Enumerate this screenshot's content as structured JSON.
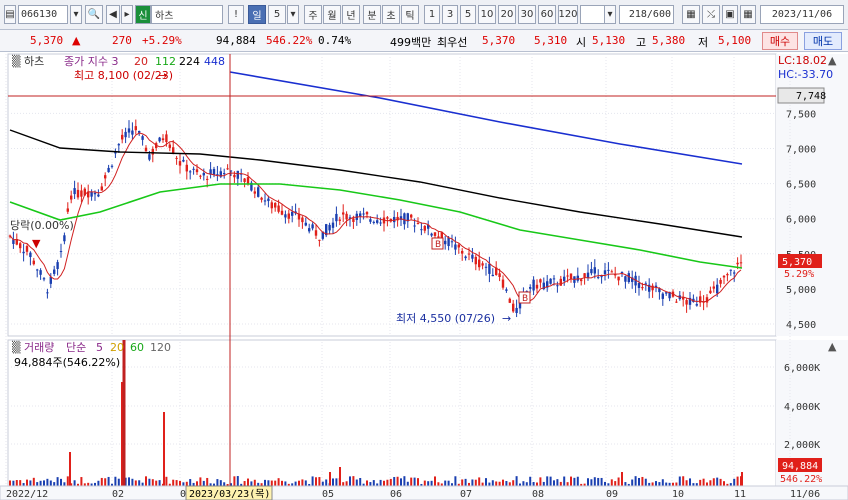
{
  "toolbar": {
    "code": "066130",
    "search_icon": "search-icon",
    "name_tag": "신",
    "name": "하츠",
    "alert": "!",
    "day": "일",
    "day_count": "5",
    "periods": [
      "주",
      "월",
      "년",
      "분",
      "초",
      "틱"
    ],
    "minute_opts": [
      "1",
      "3",
      "5",
      "10",
      "20",
      "30",
      "60",
      "120"
    ],
    "count": "218",
    "count_total": "/600",
    "date": "2023/11/06"
  },
  "info": {
    "price": "5,370",
    "change": "270",
    "change_pct": "+5.29%",
    "volume": "94,884",
    "vol_pct": "546.22%",
    "turnover": "0.74%",
    "mcap": "499백만",
    "best_label": "최우선",
    "best_ask": "5,370",
    "best_bid": "5,310",
    "open_label": "시",
    "open": "5,130",
    "high_label": "고",
    "high": "5,380",
    "low_label": "저",
    "low": "5,100",
    "buy": "매수",
    "sell": "매도"
  },
  "price_panel": {
    "name_label": "하츠",
    "legend": "종가 지수 3",
    "ma": [
      "20",
      "112",
      "224",
      "448"
    ],
    "ma_colors": [
      "#d02020",
      "#18c818",
      "#000000",
      "#1a2fd0"
    ],
    "high_note": "최고 8,100 (02/23)",
    "low_note": "최저 4,550 (07/26)",
    "left_note": "당락(0.00%)",
    "lc": "LC:18.02",
    "hc": "HC:-33.70",
    "hline_value": "7,748",
    "last_price": "5,370",
    "last_pct": "5.29%",
    "y_ticks": [
      "7,500",
      "7,000",
      "6,500",
      "6,000",
      "5,500",
      "5,000",
      "4,500"
    ],
    "b_markers": [
      "B",
      "B"
    ]
  },
  "volume_panel": {
    "legend": "거래량",
    "legend2": "단순",
    "ma": [
      "5",
      "20",
      "60",
      "120"
    ],
    "value_note": "94,884주(546.22%)",
    "y_ticks": [
      "6,000K",
      "4,000K",
      "2,000K"
    ],
    "last_vol": "94,884",
    "last_pct": "546.22%"
  },
  "x_axis": {
    "labels": [
      "2022/12",
      "02",
      "03",
      "05",
      "06",
      "07",
      "08",
      "09",
      "10",
      "11",
      "11/06"
    ],
    "cursor_label": "2023/03/23(목)"
  },
  "colors": {
    "up": "#e0201a",
    "down": "#1a3fb0",
    "grid": "#e4e6ee"
  }
}
